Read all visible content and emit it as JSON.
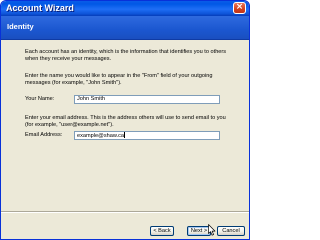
{
  "window": {
    "title": "Account Wizard",
    "close_glyph": "×"
  },
  "header": {
    "title": "Identity"
  },
  "content": {
    "intro": "Each account has an identity, which is the information that identifies you to others when they receive your messages.",
    "name_prompt": "Enter the name you would like to appear in the \"From\" field of your outgoing messages (for example, \"John Smith\").",
    "name_label": "Your Name:",
    "name_value": "John Smith",
    "email_prompt": "Enter your email address. This is the address others will use to send email to you (for example, \"user@example.net\").",
    "email_label": "Email Address:",
    "email_value": "example@shaw.ca"
  },
  "buttons": {
    "back_label": "< Back",
    "next_label": "Next >",
    "cancel_label": "Cancel"
  },
  "colors": {
    "title_bar": "#0058e6",
    "header_band": "#2f6adf",
    "dialog_face": "#ece9d8"
  },
  "icons": {
    "close": "close-icon",
    "pointer": "mouse-pointer-icon"
  }
}
